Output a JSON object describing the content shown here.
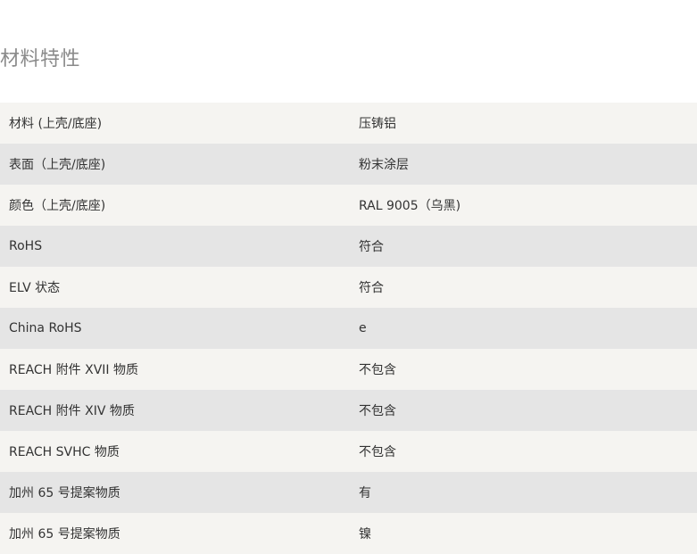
{
  "section": {
    "title": "材料特性"
  },
  "rows": [
    {
      "label": "材料 (上壳/底座)",
      "value": "压铸铝"
    },
    {
      "label": "表面（上壳/底座)",
      "value": "粉末涂层"
    },
    {
      "label": "颜色（上壳/底座)",
      "value": "RAL 9005（乌黑)"
    },
    {
      "label": "RoHS",
      "value": "符合"
    },
    {
      "label": "ELV 状态",
      "value": "符合"
    },
    {
      "label": "China RoHS",
      "value": "e"
    },
    {
      "label": "REACH 附件 XVII 物质",
      "value": "不包含"
    },
    {
      "label": "REACH 附件 XIV 物质",
      "value": "不包含"
    },
    {
      "label": "REACH SVHC 物质",
      "value": "不包含"
    },
    {
      "label": "加州 65 号提案物质",
      "value": "有"
    },
    {
      "label": "加州 65 号提案物质",
      "value": "镍"
    }
  ]
}
